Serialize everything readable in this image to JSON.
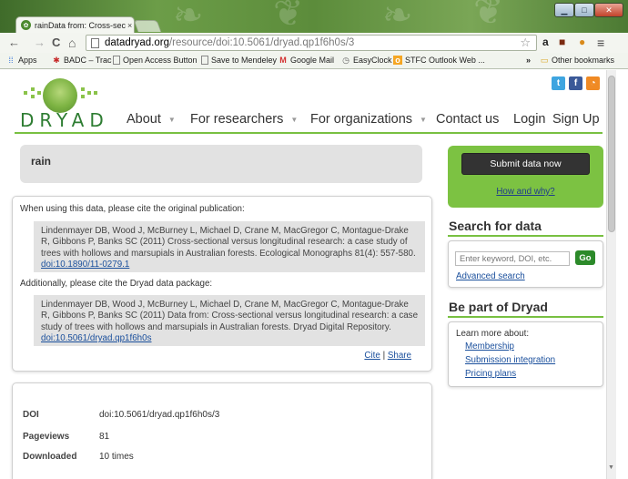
{
  "browser": {
    "tab_title": "rainData from: Cross-secti",
    "tab_close": "×",
    "url_host": "datadryad.org",
    "url_path": "/resource/doi:10.5061/dryad.qp1f6h0s/3",
    "nav": {
      "back": "←",
      "forward": "→",
      "reload": "C",
      "home": "⌂"
    },
    "window_buttons": {
      "minimize": "▁",
      "maximize": "□",
      "close": "✕"
    },
    "bookmarks": [
      {
        "label": "Apps",
        "icon": "apps-grid-icon"
      },
      {
        "label": "BADC – Trac",
        "icon": "trac-icon"
      },
      {
        "label": "Open Access Button",
        "icon": "page-icon"
      },
      {
        "label": "Save to Mendeley",
        "icon": "page-icon"
      },
      {
        "label": "Google Mail",
        "icon": "gmail-icon"
      },
      {
        "label": "EasyClock",
        "icon": "clock-icon"
      },
      {
        "label": "STFC Outlook Web ...",
        "icon": "outlook-icon"
      }
    ],
    "bookmarks_overflow": "»",
    "other_bookmarks": "Other bookmarks"
  },
  "site": {
    "logo_text": "DRYAD",
    "social": [
      "twitter-icon",
      "facebook-icon",
      "rss-icon"
    ],
    "nav": [
      {
        "label": "About",
        "dropdown": true
      },
      {
        "label": "For researchers",
        "dropdown": true
      },
      {
        "label": "For organizations",
        "dropdown": true
      },
      {
        "label": "Contact us",
        "dropdown": false
      },
      {
        "label": "Login",
        "dropdown": false
      },
      {
        "label": "Sign Up",
        "dropdown": false
      }
    ],
    "accent_color": "#78c041"
  },
  "dataset": {
    "title": "rain",
    "cite_intro": "When using this data, please cite the original publication:",
    "publication_citation": "Lindenmayer DB, Wood J, McBurney L, Michael D, Crane M, MacGregor C, Montague-Drake R, Gibbons P, Banks SC (2011) Cross-sectional versus longitudinal research: a case study of trees with hollows and marsupials in Australian forests. Ecological Monographs 81(4): 557-580.",
    "publication_doi": "doi:10.1890/11-0279.1",
    "package_intro": "Additionally, please cite the Dryad data package:",
    "package_citation": "Lindenmayer DB, Wood J, McBurney L, Michael D, Crane M, MacGregor C, Montague-Drake R, Gibbons P, Banks SC (2011) Data from: Cross-sectional versus longitudinal research: a case study of trees with hollows and marsupials in Australian forests. Dryad Digital Repository.",
    "package_doi": "doi:10.5061/dryad.qp1f6h0s",
    "cite_link": "Cite",
    "separator": "|",
    "share_link": "Share",
    "stats": [
      {
        "label": "DOI",
        "value": "doi:10.5061/dryad.qp1f6h0s/3"
      },
      {
        "label": "Pageviews",
        "value": "81"
      },
      {
        "label": "Downloaded",
        "value": "10 times"
      }
    ]
  },
  "sidebar": {
    "submit_button": "Submit data now",
    "how_link": "How and why?",
    "search_heading": "Search for data",
    "search_placeholder": "Enter keyword, DOI, etc.",
    "search_go": "Go",
    "advanced_search": "Advanced search",
    "partner_heading": "Be part of Dryad",
    "learn_more": "Learn more about:",
    "learn_links": [
      "Membership",
      "Submission integration",
      "Pricing plans"
    ]
  }
}
